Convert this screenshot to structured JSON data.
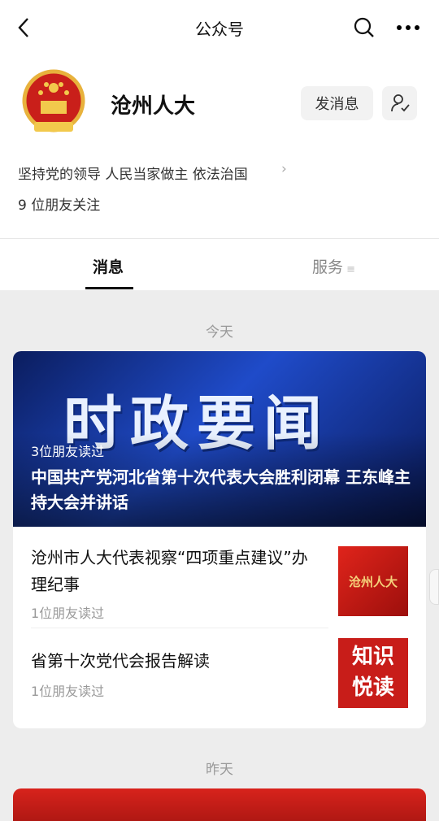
{
  "nav": {
    "title": "公众号"
  },
  "account": {
    "name": "沧州人大",
    "message_btn": "发消息",
    "intro": "坚持党的领导 人民当家做主 依法治国",
    "followers": "9 位朋友关注"
  },
  "tabs": {
    "messages": "消息",
    "services": "服务"
  },
  "feed": {
    "today": "今天",
    "yesterday": "昨天",
    "banner_text": "时政要闻",
    "lead_read": "3位朋友读过",
    "lead_title": "中国共产党河北省第十次代表大会胜利闭幕 王东峰主持大会并讲话",
    "item1": {
      "title": "沧州市人大代表视察“四项重点建议”办理纪事",
      "read": "1位朋友读过",
      "thumb": "沧州人大"
    },
    "item2": {
      "title": "省第十次党代会报告解读",
      "read": "1位朋友读过",
      "thumb1": "知识",
      "thumb2": "悦读"
    }
  }
}
